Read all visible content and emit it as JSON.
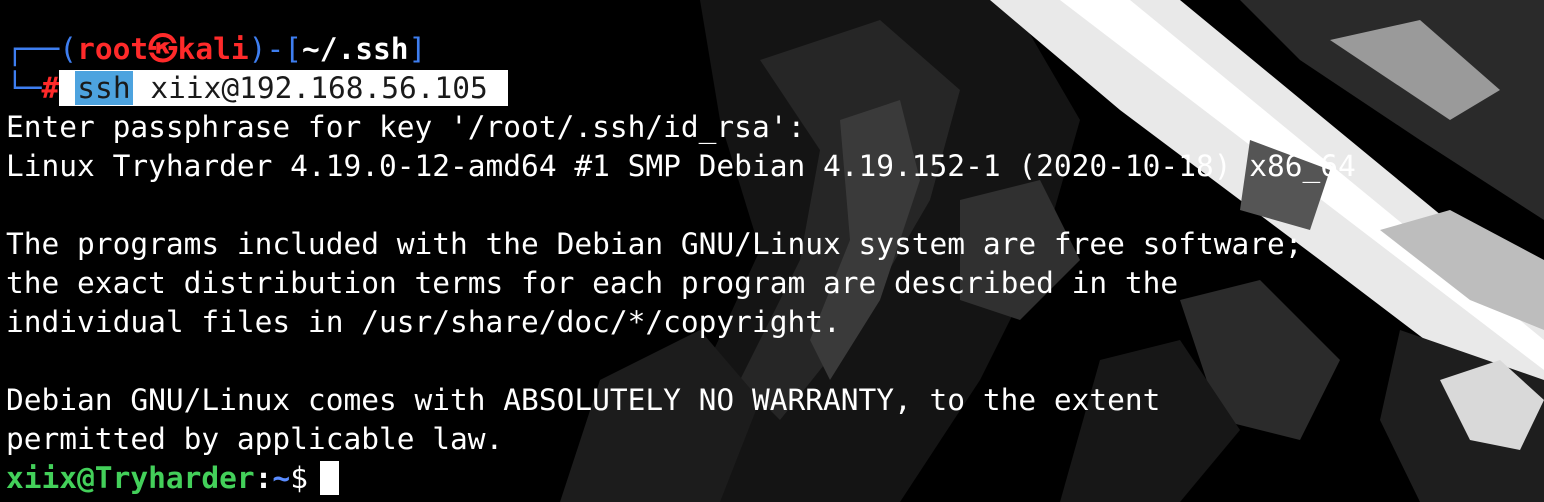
{
  "prompt": {
    "open_paren": "(",
    "user": "root",
    "symbol": "㉿",
    "host": "kali",
    "close_paren": ")",
    "dash": "-",
    "dir_open": "[",
    "dir": "~/.ssh",
    "dir_close": "]",
    "hash": "#",
    "command_name": "ssh",
    "command_args": "xiix@192.168.56.105"
  },
  "output_lines": [
    "Enter passphrase for key '/root/.ssh/id_rsa':",
    "Linux Tryharder 4.19.0-12-amd64 #1 SMP Debian 4.19.152-1 (2020-10-18) x86_64",
    "",
    "The programs included with the Debian GNU/Linux system are free software;",
    "the exact distribution terms for each program are described in the",
    "individual files in /usr/share/doc/*/copyright.",
    "",
    "Debian GNU/Linux comes with ABSOLUTELY NO WARRANTY, to the extent",
    "permitted by applicable law."
  ],
  "remote_prompt": {
    "user_host": "xiix@Tryharder",
    "colon": ":",
    "path": "~",
    "dollar": "$"
  },
  "colors": {
    "background": "#000000",
    "prompt_blue": "#3e7ef0",
    "prompt_red": "#ff2a2a",
    "remote_green": "#43d05a",
    "highlight_blue": "#4da3df"
  }
}
